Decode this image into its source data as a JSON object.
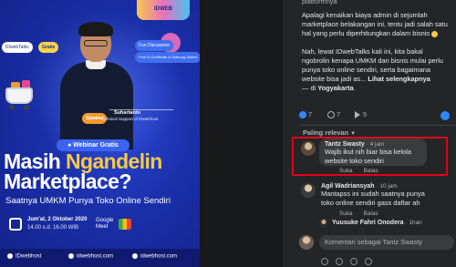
{
  "poster": {
    "logo": "IDWEB",
    "chip_idweb": "IDwebTalks",
    "chip_gratis": "Gratis",
    "chip_fun": "Fun Discussion",
    "chip_fun_sub": "Free E-Certificate & Softcopy Materi",
    "chip_speaker": "Speaker",
    "speaker_name": "Suhartanto",
    "speaker_role": "Technical Support of IDwebhost",
    "webinar_label": "● Webinar Gratis",
    "headline_pre": "Masih ",
    "headline_accent": "Ngandelin",
    "headline_l2": "Marketplace?",
    "subtitle": "Saatnya UMKM Punya Toko Online Sendiri",
    "date": "Jum'at, 2 Oktober 2020",
    "time": "14.00 s.d. 16.00 WIB",
    "gmeet_1": "Google",
    "gmeet_2": "Meet",
    "footer": [
      "IDwebhost",
      "idwebhost.com",
      "idwebhost.com"
    ]
  },
  "post": {
    "lines": [
      "platformnya",
      "Apalagi kenaikan biaya admin di sejumlah",
      "marketplace belakangan ini, tentu jadi salah satu",
      "hal yang perlu diperhitungkan dalam bisnis",
      "Nah, lewat IDwebTalks kali ini, kita bakal",
      "ngobrolin kenapa UMKM dan bisnis mulai perlu",
      "punya toko online sendiri, serta bagaimana",
      "website bisa jadi as..."
    ],
    "see_more": "Lihat selengkapnya",
    "location_prefix": "— di ",
    "location": "Yogyakarta",
    "location_suffix": "."
  },
  "stats": {
    "likes": "7",
    "comments": "7",
    "shares": "5"
  },
  "sort_label": "Paling relevan",
  "comments": [
    {
      "name": "Tantz Swasty",
      "time": "· 4 jam",
      "lines": [
        "Wajib ikut nih biar bisa kelola",
        "website toko sendiri"
      ],
      "like": "Suka",
      "reply": "Balas"
    },
    {
      "name": "Agil Wadriansyah",
      "time": "· 10 jam",
      "lines": [
        "Mantapss ini sudah saatnya punya",
        "toko online sendiri gass daftar ah"
      ],
      "like": "Suka",
      "reply": "Balas"
    },
    {
      "name": "Yuusuke Fahri Onodera",
      "time": "· 1hari",
      "lines": [],
      "like": "",
      "reply": ""
    }
  ],
  "comment_input_placeholder": "Komentari sebagai Tantz Swasty"
}
